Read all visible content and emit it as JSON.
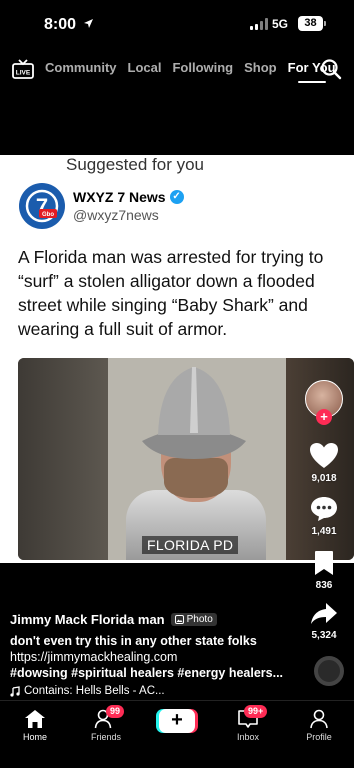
{
  "status_bar": {
    "time": "8:00",
    "network": "5G",
    "battery": "38"
  },
  "top_nav": {
    "live_label": "LIVE",
    "tabs": [
      {
        "label": "Community"
      },
      {
        "label": "Local"
      },
      {
        "label": "Following"
      },
      {
        "label": "Shop"
      },
      {
        "label": "For You"
      }
    ],
    "active_tab": "For You"
  },
  "post": {
    "suggested_label": "Suggested for you",
    "account_name": "WXYZ 7 News",
    "account_handle": "@wxyz7news",
    "logo_text": "7",
    "logo_subtext": "Gbo",
    "text": "A Florida man was arrested for trying to “surf” a stolen alligator down a flooded street while singing “Baby Shark” and wearing a full suit of armor.",
    "photo_label": "FLORIDA PD"
  },
  "right_rail": {
    "likes": "9,018",
    "comments": "1,491",
    "saves": "836",
    "shares": "5,324"
  },
  "caption": {
    "username": "Jimmy Mack Florida man",
    "photo_badge": "Photo",
    "description": "don't even try this in any other state folks",
    "link": "https://jimmymackhealing.com",
    "hashtags": "#dowsing #spiritual healers #energy healers...",
    "music": "Contains: Hells Bells - AC..."
  },
  "bottom_nav": {
    "home": "Home",
    "friends": "Friends",
    "friends_badge": "99",
    "inbox": "Inbox",
    "inbox_badge": "99+",
    "profile": "Profile"
  },
  "colors": {
    "accent": "#fe2c55",
    "cyan": "#25f4ee",
    "verified": "#1da1f2"
  }
}
